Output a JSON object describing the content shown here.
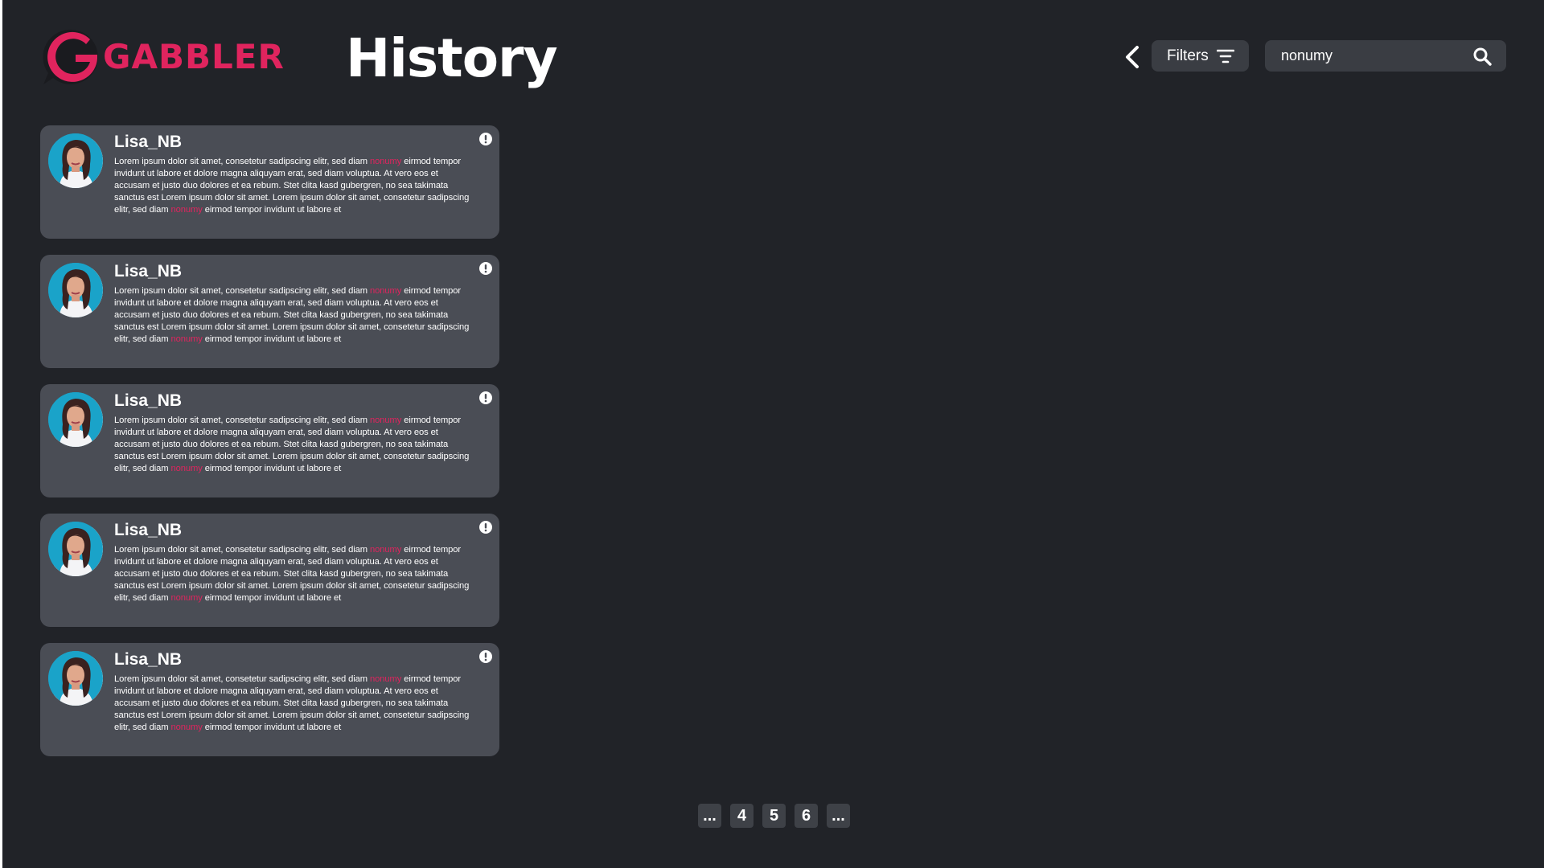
{
  "brand": {
    "name": "GABBLER",
    "accent": "#e0245e"
  },
  "header": {
    "title": "History",
    "filters_label": "Filters",
    "search": {
      "value": "nonumy",
      "placeholder": ""
    }
  },
  "messages": [
    {
      "username": "Lisa_NB",
      "text_1": "Lorem ipsum dolor sit amet, consetetur sadipscing elitr, sed diam ",
      "highlight_1": "nonumy",
      "text_2": " eirmod tempor invidunt ut labore et dolore magna aliquyam erat, sed diam voluptua. At vero eos et accusam et justo duo dolores et ea rebum. Stet clita kasd gubergren, no sea takimata sanctus est Lorem ipsum dolor sit amet. Lorem ipsum dolor sit amet, consetetur sadipscing elitr, sed diam ",
      "highlight_2": "nonumy",
      "text_3": " eirmod tempor invidunt ut labore et"
    },
    {
      "username": "Lisa_NB",
      "text_1": "Lorem ipsum dolor sit amet, consetetur sadipscing elitr, sed diam ",
      "highlight_1": "nonumy",
      "text_2": " eirmod tempor invidunt ut labore et dolore magna aliquyam erat, sed diam voluptua. At vero eos et accusam et justo duo dolores et ea rebum. Stet clita kasd gubergren, no sea takimata sanctus est Lorem ipsum dolor sit amet. Lorem ipsum dolor sit amet, consetetur sadipscing elitr, sed diam ",
      "highlight_2": "nonumy",
      "text_3": " eirmod tempor invidunt ut labore et"
    },
    {
      "username": "Lisa_NB",
      "text_1": "Lorem ipsum dolor sit amet, consetetur sadipscing elitr, sed diam ",
      "highlight_1": "nonumy",
      "text_2": " eirmod tempor invidunt ut labore et dolore magna aliquyam erat, sed diam voluptua. At vero eos et accusam et justo duo dolores et ea rebum. Stet clita kasd gubergren, no sea takimata sanctus est Lorem ipsum dolor sit amet. Lorem ipsum dolor sit amet, consetetur sadipscing elitr, sed diam ",
      "highlight_2": "nonumy",
      "text_3": " eirmod tempor invidunt ut labore et"
    },
    {
      "username": "Lisa_NB",
      "text_1": "Lorem ipsum dolor sit amet, consetetur sadipscing elitr, sed diam ",
      "highlight_1": "nonumy",
      "text_2": " eirmod tempor invidunt ut labore et dolore magna aliquyam erat, sed diam voluptua. At vero eos et accusam et justo duo dolores et ea rebum. Stet clita kasd gubergren, no sea takimata sanctus est Lorem ipsum dolor sit amet. Lorem ipsum dolor sit amet, consetetur sadipscing elitr, sed diam ",
      "highlight_2": "nonumy",
      "text_3": " eirmod tempor invidunt ut labore et"
    },
    {
      "username": "Lisa_NB",
      "text_1": "Lorem ipsum dolor sit amet, consetetur sadipscing elitr, sed diam ",
      "highlight_1": "nonumy",
      "text_2": " eirmod tempor invidunt ut labore et dolore magna aliquyam erat, sed diam voluptua. At vero eos et accusam et justo duo dolores et ea rebum. Stet clita kasd gubergren, no sea takimata sanctus est Lorem ipsum dolor sit amet. Lorem ipsum dolor sit amet, consetetur sadipscing elitr, sed diam ",
      "highlight_2": "nonumy",
      "text_3": " eirmod tempor invidunt ut labore et"
    }
  ],
  "pagination": {
    "pages": [
      "...",
      "4",
      "5",
      "6",
      "..."
    ]
  },
  "icons": {
    "back": "chevron-left-icon",
    "filters": "filter-lines-icon",
    "search": "search-icon",
    "report": "exclamation-circle-icon",
    "avatar": "user-photo"
  }
}
